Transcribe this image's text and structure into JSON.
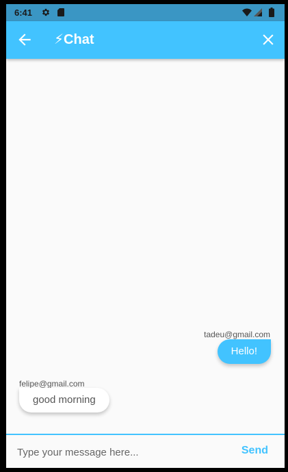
{
  "status_bar": {
    "time": "6:41",
    "icons": [
      "gear-icon",
      "sd-card-icon",
      "wifi-icon",
      "signal-icon",
      "battery-icon"
    ],
    "background": "#3a96c4"
  },
  "app_bar": {
    "title": "⚡Chat",
    "back_icon": "arrow-left-icon",
    "close_icon": "close-icon",
    "background": "#42c3ff"
  },
  "messages": [
    {
      "sender": "tadeu@gmail.com",
      "text": "Hello!",
      "direction": "sent"
    },
    {
      "sender": "felipe@gmail.com",
      "text": "good morning",
      "direction": "received"
    }
  ],
  "composer": {
    "placeholder": "Type your message here...",
    "value": "",
    "send_label": "Send"
  },
  "colors": {
    "accent": "#42c3ff",
    "received_bubble": "#ffffff",
    "background": "#fafafa"
  }
}
